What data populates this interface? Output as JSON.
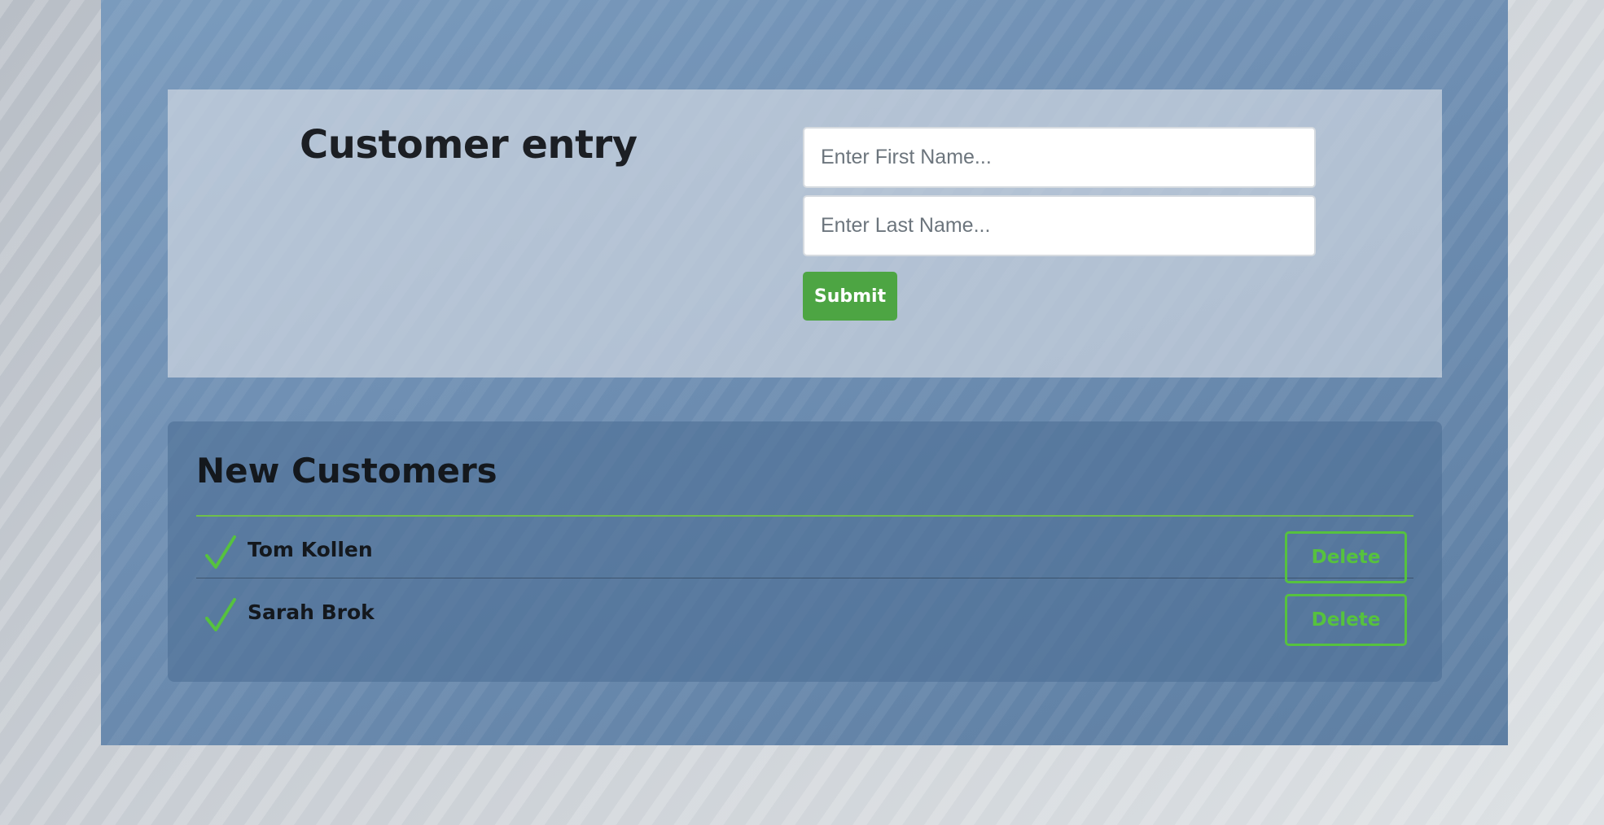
{
  "entry": {
    "title": "Customer entry",
    "first_name_placeholder": "Enter First Name...",
    "last_name_placeholder": "Enter Last Name...",
    "submit_label": "Submit"
  },
  "customers": {
    "title": "New Customers",
    "rows": [
      {
        "name": "Tom Kollen",
        "delete_label": "Delete"
      },
      {
        "name": "Sarah Brok",
        "delete_label": "Delete"
      }
    ]
  },
  "colors": {
    "accent_green": "#56c23e",
    "submit_green": "#4da543",
    "frame_blue": "#6f8fb3"
  },
  "icons": {
    "row_check": "check-icon"
  }
}
